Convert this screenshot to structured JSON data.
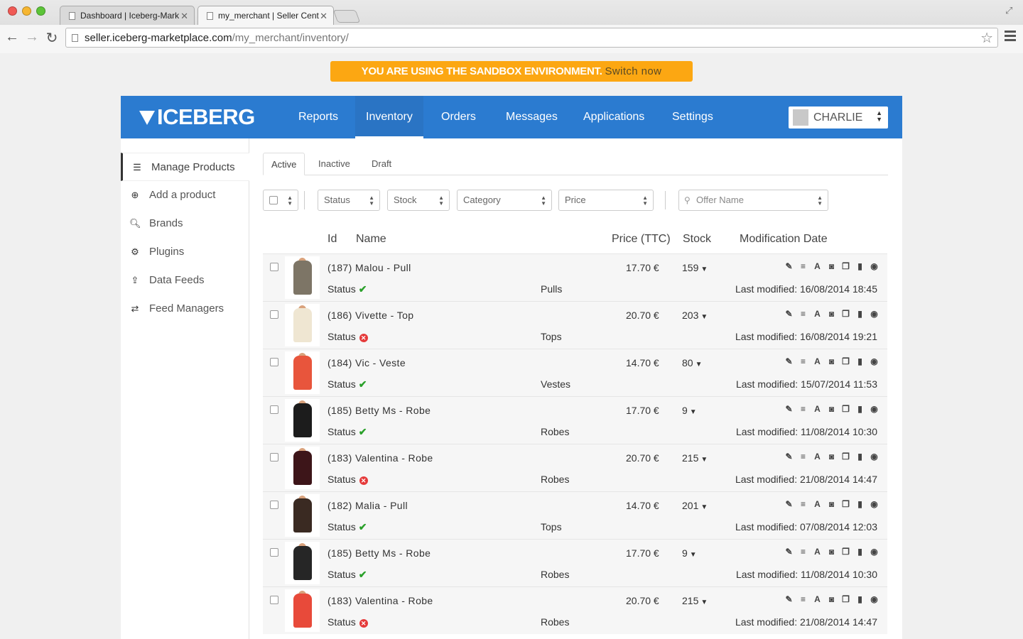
{
  "browser": {
    "tabs": [
      {
        "label": "Dashboard | Iceberg-Mark"
      },
      {
        "label": "my_merchant | Seller Cent"
      }
    ],
    "url_host": "seller.iceberg-marketplace.com",
    "url_path": "/my_merchant/inventory/"
  },
  "banner": {
    "text": "YOU ARE USING THE SANDBOX ENVIRONMENT.",
    "link": "Switch now"
  },
  "header": {
    "logo": "ICEBERG",
    "nav": [
      "Reports",
      "Inventory",
      "Orders",
      "Messages",
      "Applications",
      "Settings"
    ],
    "user": "CHARLIE"
  },
  "sidebar": {
    "items": [
      {
        "label": "Manage Products",
        "icon": "list-icon"
      },
      {
        "label": "Add a product",
        "icon": "plus-circle-icon"
      },
      {
        "label": "Brands",
        "icon": "search-icon"
      },
      {
        "label": "Plugins",
        "icon": "gears-icon"
      },
      {
        "label": "Data Feeds",
        "icon": "share-icon"
      },
      {
        "label": "Feed Managers",
        "icon": "exchange-icon"
      }
    ]
  },
  "tabs": [
    "Active",
    "Inactive",
    "Draft"
  ],
  "filters": {
    "status": "Status",
    "stock": "Stock",
    "category": "Category",
    "price": "Price",
    "search_placeholder": "Offer Name"
  },
  "columns": {
    "id": "Id",
    "name": "Name",
    "price": "Price (TTC)",
    "stock": "Stock",
    "modified": "Modification Date"
  },
  "status_label": "Status",
  "rows": [
    {
      "name": "(187) Malou - Pull",
      "status": "ok",
      "category": "Pulls",
      "price": "17.70 €",
      "stock": "159",
      "modified": "Last modified: 16/08/2014 18:45",
      "color": "#7d7566"
    },
    {
      "name": "(186) Vivette - Top",
      "status": "ko",
      "category": "Tops",
      "price": "20.70 €",
      "stock": "203",
      "modified": "Last modified: 16/08/2014 19:21",
      "color": "#efe6d2"
    },
    {
      "name": "(184) Vic - Veste",
      "status": "ok",
      "category": "Vestes",
      "price": "14.70 €",
      "stock": "80",
      "modified": "Last modified: 15/07/2014 11:53",
      "color": "#e8553c"
    },
    {
      "name": "(185) Betty Ms - Robe",
      "status": "ok",
      "category": "Robes",
      "price": "17.70 €",
      "stock": "9",
      "modified": "Last modified: 11/08/2014 10:30",
      "color": "#1c1c1c"
    },
    {
      "name": "(183) Valentina - Robe",
      "status": "ko",
      "category": "Robes",
      "price": "20.70 €",
      "stock": "215",
      "modified": "Last modified: 21/08/2014 14:47",
      "color": "#3d1519"
    },
    {
      "name": "(182) Malia - Pull",
      "status": "ok",
      "category": "Tops",
      "price": "14.70 €",
      "stock": "201",
      "modified": "Last modified: 07/08/2014 12:03",
      "color": "#3a2a22"
    },
    {
      "name": "(185) Betty Ms - Robe",
      "status": "ok",
      "category": "Robes",
      "price": "17.70 €",
      "stock": "9",
      "modified": "Last modified: 11/08/2014 10:30",
      "color": "#262626"
    },
    {
      "name": "(183) Valentina - Robe",
      "status": "ko",
      "category": "Robes",
      "price": "20.70 €",
      "stock": "215",
      "modified": "Last modified: 21/08/2014 14:47",
      "color": "#e84a3a"
    }
  ],
  "row_actions": [
    "edit-icon",
    "list-icon",
    "translate-icon",
    "camera-icon",
    "copy-icon",
    "trash-icon",
    "eye-icon"
  ]
}
